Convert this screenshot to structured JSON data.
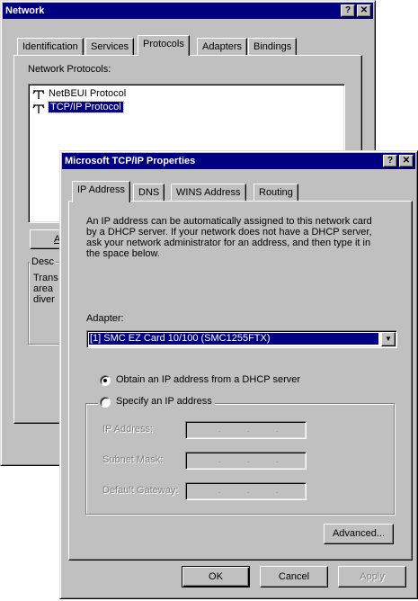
{
  "network_window": {
    "title": "Network",
    "help_glyph": "?",
    "close_glyph": "✕",
    "tabs": [
      {
        "label": "Identification"
      },
      {
        "label": "Services"
      },
      {
        "label": "Protocols"
      },
      {
        "label": "Adapters"
      },
      {
        "label": "Bindings"
      }
    ],
    "protocols_label": "Network Protocols:",
    "protocols": [
      {
        "label": "NetBEUI Protocol",
        "selected": false
      },
      {
        "label": "TCP/IP Protocol",
        "selected": true
      }
    ],
    "add_button_fragment": "A",
    "description_group_fragment": "Desc",
    "description_lines": [
      "Trans",
      "area",
      "diver"
    ]
  },
  "tcpip_dialog": {
    "title": "Microsoft TCP/IP Properties",
    "help_glyph": "?",
    "close_glyph": "✕",
    "tabs": [
      {
        "label": "IP Address",
        "active": true
      },
      {
        "label": "DNS",
        "active": false
      },
      {
        "label": "WINS Address",
        "active": false
      },
      {
        "label": "Routing",
        "active": false
      }
    ],
    "description_lines": [
      "An IP address can be automatically assigned to this network card",
      "by a DHCP server.  If your network does not have a DHCP server,",
      "ask your network administrator for an address, and then type it in",
      "the space below."
    ],
    "adapter_label": "Adapter:",
    "adapter_selected": "[1] SMC EZ Card 10/100 (SMC1255FTX)",
    "dropdown_arrow": "▼",
    "radio_dhcp_label": "Obtain an IP address from a DHCP server",
    "radio_dhcp_checked": true,
    "radio_specify_label": "Specify an IP address",
    "radio_specify_checked": false,
    "fields": [
      {
        "label": "IP Address:"
      },
      {
        "label": "Subnet Mask:"
      },
      {
        "label": "Default Gateway:"
      }
    ],
    "ip_separator": ".",
    "advanced_button": "Advanced...",
    "ok_button": "OK",
    "cancel_button": "Cancel",
    "apply_button": "Apply"
  },
  "colors": {
    "face": "#c0c0c0",
    "titlebar": "#000080",
    "selection": "#000080",
    "disabled_text": "#808080"
  }
}
